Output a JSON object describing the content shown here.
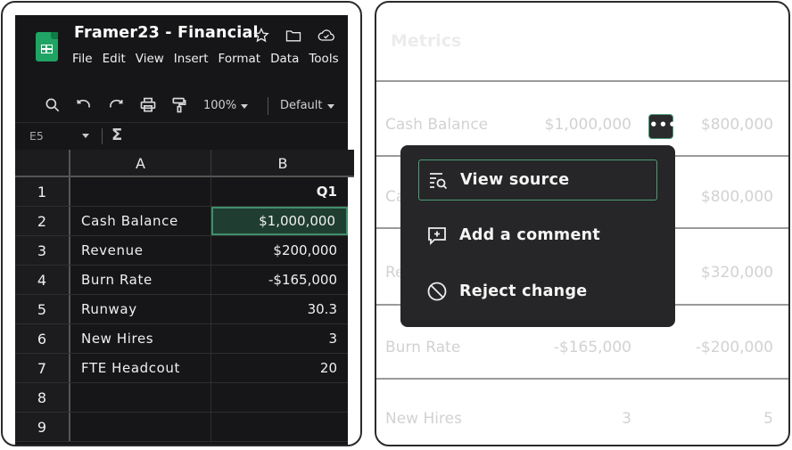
{
  "spreadsheet": {
    "title": "Framer23 - Financial",
    "menu": [
      "File",
      "Edit",
      "View",
      "Insert",
      "Format",
      "Data",
      "Tools"
    ],
    "toolbar": {
      "zoom": "100%",
      "font": "Default"
    },
    "formula_bar": {
      "cell_ref": "E5",
      "function_symbol": "Σ"
    },
    "columns": [
      "A",
      "B"
    ],
    "rows": [
      {
        "num": "1",
        "a": "",
        "b": "Q1"
      },
      {
        "num": "2",
        "a": "Cash Balance",
        "b": "$1,000,000"
      },
      {
        "num": "3",
        "a": "Revenue",
        "b": "$200,000"
      },
      {
        "num": "4",
        "a": "Burn Rate",
        "b": "-$165,000"
      },
      {
        "num": "5",
        "a": "Runway",
        "b": "30.3"
      },
      {
        "num": "6",
        "a": "New Hires",
        "b": "3"
      },
      {
        "num": "7",
        "a": "FTE Headcout",
        "b": "20"
      },
      {
        "num": "8",
        "a": "",
        "b": ""
      },
      {
        "num": "9",
        "a": "",
        "b": ""
      }
    ],
    "selected_cell_color": "#3f8f69"
  },
  "metrics": {
    "title": "Metrics",
    "rows": [
      {
        "label": "Cash Balance",
        "v1": "$1,000,000",
        "v2": "$800,000"
      },
      {
        "label": "Ca",
        "v1": "",
        "v2": "$800,000"
      },
      {
        "label": "Re",
        "v1": "",
        "v2": "$320,000"
      },
      {
        "label": "Burn Rate",
        "v1": "-$165,000",
        "v2": "-$200,000"
      },
      {
        "label": "New Hires",
        "v1": "3",
        "v2": "5"
      }
    ]
  },
  "context_menu": {
    "more_button": "•••",
    "items": [
      {
        "label": "View source",
        "icon": "view-source-icon"
      },
      {
        "label": "Add a comment",
        "icon": "add-comment-icon"
      },
      {
        "label": "Reject change",
        "icon": "reject-icon"
      }
    ],
    "accent": "#4b9c74"
  }
}
